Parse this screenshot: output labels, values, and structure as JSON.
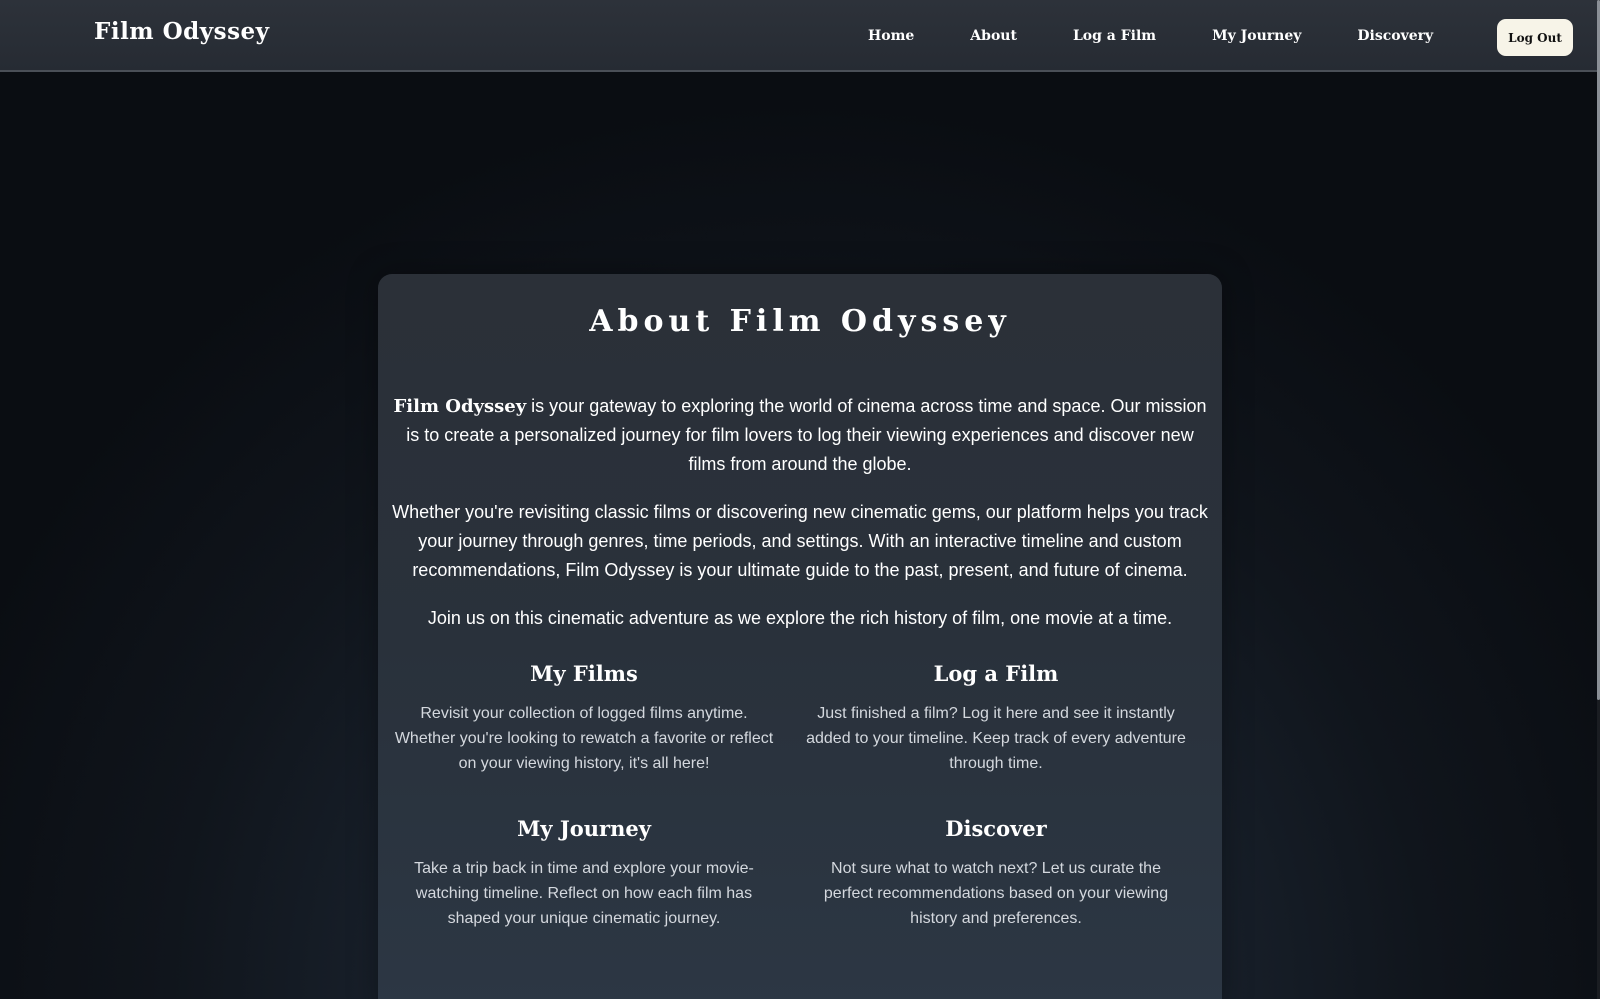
{
  "nav": {
    "brand": "Film Odyssey",
    "links": [
      "Home",
      "About",
      "Log a Film",
      "My Journey",
      "Discovery"
    ],
    "logout_label": "Log Out"
  },
  "about": {
    "title": "About Film Odyssey",
    "intro_brand": "Film Odyssey",
    "intro_rest": " is your gateway to exploring the world of cinema across time and space. Our mission is to create a personalized journey for film lovers to log their viewing experiences and discover new films from around the globe.",
    "paragraph_2": "Whether you're revisiting classic films or discovering new cinematic gems, our platform helps you track your journey through genres, time periods, and settings. With an interactive timeline and custom recommendations, Film Odyssey is your ultimate guide to the past, present, and future of cinema.",
    "paragraph_3": "Join us on this cinematic adventure as we explore the rich history of film, one movie at a time.",
    "features": [
      {
        "title": "My Films",
        "text": "Revisit your collection of logged films anytime. Whether you're looking to rewatch a favorite or reflect on your viewing history, it's all here!"
      },
      {
        "title": "Log a Film",
        "text": "Just finished a film? Log it here and see it instantly added to your timeline. Keep track of every adventure through time."
      },
      {
        "title": "My Journey",
        "text": "Take a trip back in time and explore your movie-watching timeline. Reflect on how each film has shaped your unique cinematic journey."
      },
      {
        "title": "Discover",
        "text": "Not sure what to watch next? Let us curate the perfect recommendations based on your viewing history and preferences."
      }
    ]
  },
  "colors": {
    "navbar_bg": "#2b3038",
    "logout_bg": "#f7f4e8",
    "card_bg": "#2b3038",
    "page_bg": "#0a0d12"
  }
}
